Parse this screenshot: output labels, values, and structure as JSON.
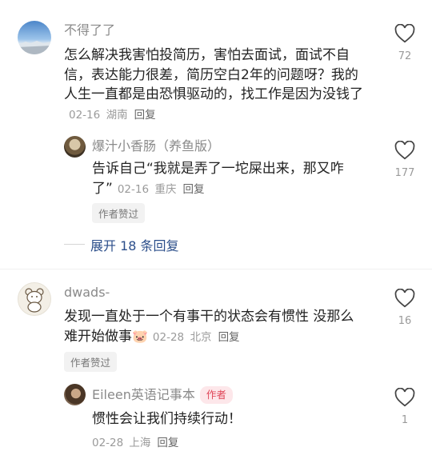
{
  "comments": [
    {
      "user": "不得了了",
      "text": "怎么解决我害怕投简历，害怕去面试，面试不自信，表达能力很差，简历空白2年的问题呀？我的人生一直都是由恐惧驱动的，找工作是因为没钱了",
      "date": "02-16",
      "location": "湖南",
      "reply_label": "回复",
      "likes": "72",
      "replies": [
        {
          "user": "爆汁小香肠（养鱼版）",
          "text": "告诉自己“我就是弄了一坨屎出来，那又咋了”",
          "date": "02-16",
          "location": "重庆",
          "reply_label": "回复",
          "likes": "177",
          "badge": "作者赞过"
        }
      ],
      "expand_label": "展开 18 条回复"
    },
    {
      "user": "dwads-",
      "text": "发现一直处于一个有事干的状态会有惯性 没那么难开始做事",
      "emoji": "🐷",
      "date": "02-28",
      "location": "北京",
      "reply_label": "回复",
      "likes": "16",
      "badge": "作者赞过",
      "replies": [
        {
          "user": "Eileen英语记事本",
          "author_tag": "作者",
          "text": "惯性会让我们持续行动！",
          "date": "02-28",
          "location": "上海",
          "reply_label": "回复",
          "likes": "1"
        }
      ]
    }
  ],
  "colors": {
    "expand_link": "#2b4e8a",
    "author_tag": "#e0485a"
  }
}
